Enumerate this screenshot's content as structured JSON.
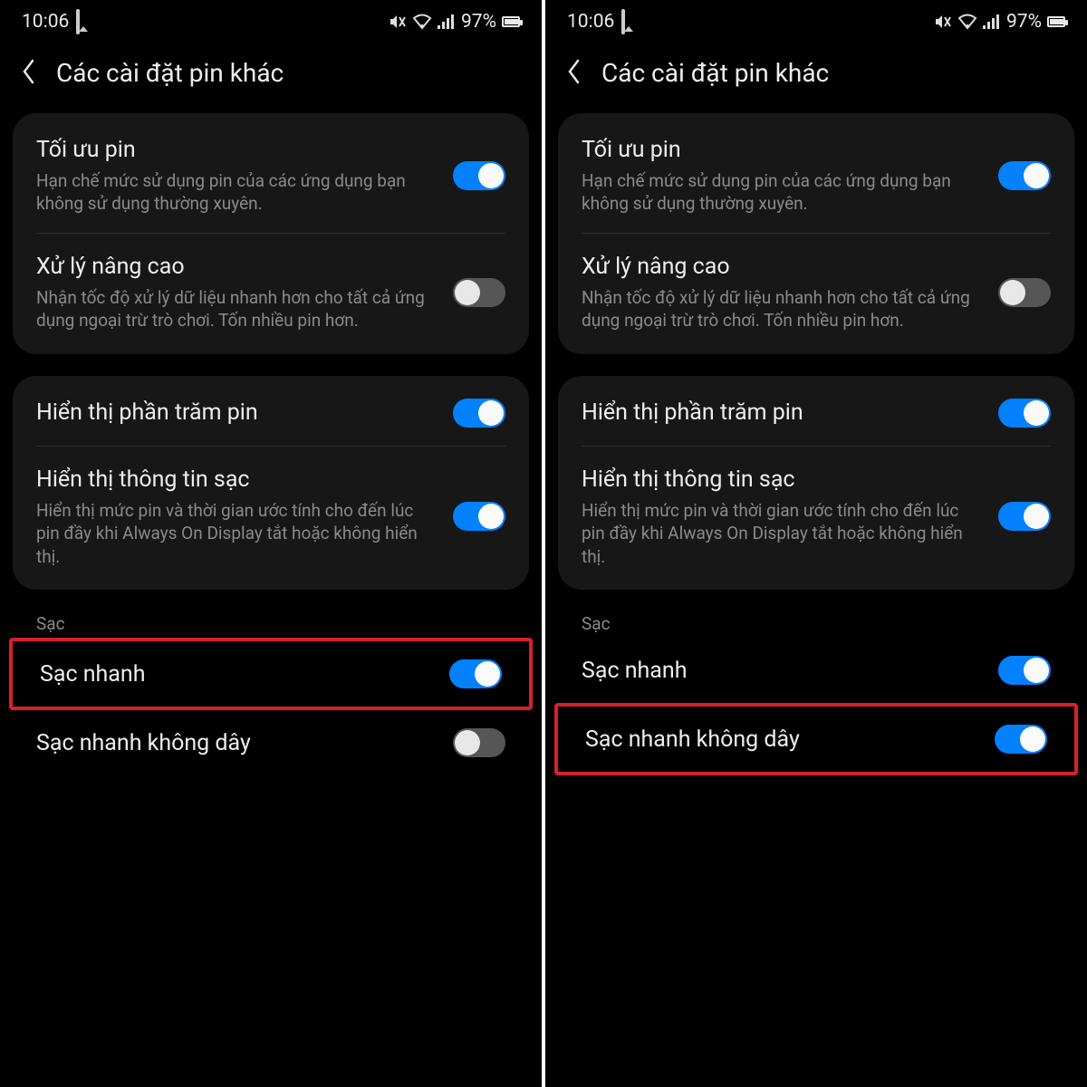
{
  "screens": [
    {
      "status": {
        "time": "10:06",
        "battery": "97%"
      },
      "title": "Các cài đặt pin khác",
      "group1": [
        {
          "title": "Tối ưu pin",
          "desc": "Hạn chế mức sử dụng pin của các ứng dụng bạn không sử dụng thường xuyên.",
          "on": true
        },
        {
          "title": "Xử lý nâng cao",
          "desc": "Nhận tốc độ xử lý dữ liệu nhanh hơn cho tất cả ứng dụng ngoại trừ trò chơi. Tốn nhiều pin hơn.",
          "on": false
        }
      ],
      "group2": [
        {
          "title": "Hiển thị phần trăm pin",
          "desc": "",
          "on": true
        },
        {
          "title": "Hiển thị thông tin sạc",
          "desc": "Hiển thị mức pin và thời gian ước tính cho đến lúc pin đầy khi Always On Display tắt hoặc không hiển thị.",
          "on": true
        }
      ],
      "sectionLabel": "Sạc",
      "charging": [
        {
          "title": "Sạc nhanh",
          "on": true,
          "highlight": true
        },
        {
          "title": "Sạc nhanh không dây",
          "on": false,
          "highlight": false
        }
      ]
    },
    {
      "status": {
        "time": "10:06",
        "battery": "97%"
      },
      "title": "Các cài đặt pin khác",
      "group1": [
        {
          "title": "Tối ưu pin",
          "desc": "Hạn chế mức sử dụng pin của các ứng dụng bạn không sử dụng thường xuyên.",
          "on": true
        },
        {
          "title": "Xử lý nâng cao",
          "desc": "Nhận tốc độ xử lý dữ liệu nhanh hơn cho tất cả ứng dụng ngoại trừ trò chơi. Tốn nhiều pin hơn.",
          "on": false
        }
      ],
      "group2": [
        {
          "title": "Hiển thị phần trăm pin",
          "desc": "",
          "on": true
        },
        {
          "title": "Hiển thị thông tin sạc",
          "desc": "Hiển thị mức pin và thời gian ước tính cho đến lúc pin đầy khi Always On Display tắt hoặc không hiển thị.",
          "on": true
        }
      ],
      "sectionLabel": "Sạc",
      "charging": [
        {
          "title": "Sạc nhanh",
          "on": true,
          "highlight": false
        },
        {
          "title": "Sạc nhanh không dây",
          "on": true,
          "highlight": true
        }
      ]
    }
  ]
}
